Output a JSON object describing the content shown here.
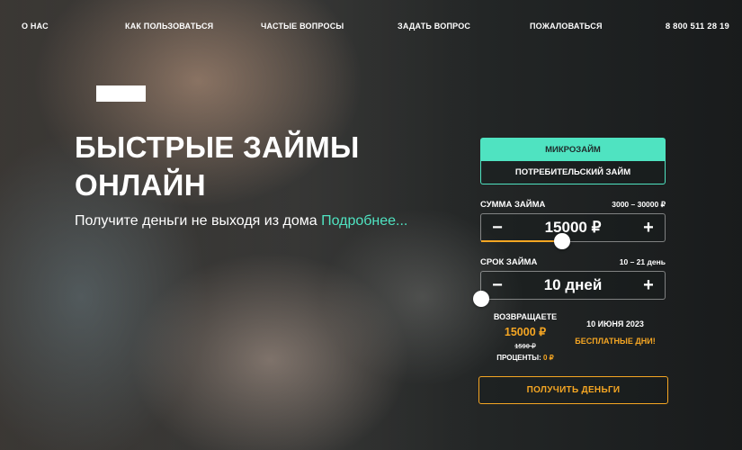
{
  "nav": {
    "about": "О НАС",
    "how_to_use": "КАК ПОЛЬЗОВАТЬСЯ",
    "faq": "ЧАСТЫЕ ВОПРОСЫ",
    "ask": "ЗАДАТЬ ВОПРОС",
    "complain": "ПОЖАЛОВАТЬСЯ",
    "phone": "8 800 511 28 19"
  },
  "hero": {
    "headline_line1": "БЫСТРЫЕ ЗАЙМЫ",
    "headline_line2": "ОНЛАЙН",
    "subline": "Получите деньги не выходя из дома ",
    "more_link": "Подробнее..."
  },
  "calculator": {
    "tab_active": "МИКРОЗАЙМ",
    "tab_inactive": "ПОТРЕБИТЕЛЬСКИЙ ЗАЙМ",
    "amount_label": "СУММА ЗАЙМА",
    "amount_range": "3000 – 30000 ₽",
    "amount_value": "15000 ₽",
    "amount_slider_fraction": 0.44,
    "term_label": "СРОК ЗАЙМА",
    "term_range": "10 – 21 день",
    "term_value": "10 дней",
    "term_slider_fraction": 0.0,
    "minus": "−",
    "plus": "+",
    "return_label": "ВОЗВРАЩАЕТЕ",
    "return_amount": "15000 ₽",
    "return_old": "1590 ₽",
    "interest_label": "ПРОЦЕНТЫ: ",
    "interest_value": "0 ₽",
    "return_date": "10 ИЮНЯ 2023",
    "free_days": "БЕСПЛАТНЫЕ ДНИ!"
  },
  "cta": {
    "label": "ПОЛУЧИТЬ ДЕНЬГИ"
  },
  "colors": {
    "accent": "#4fe3c1",
    "orange": "#f5a623"
  }
}
